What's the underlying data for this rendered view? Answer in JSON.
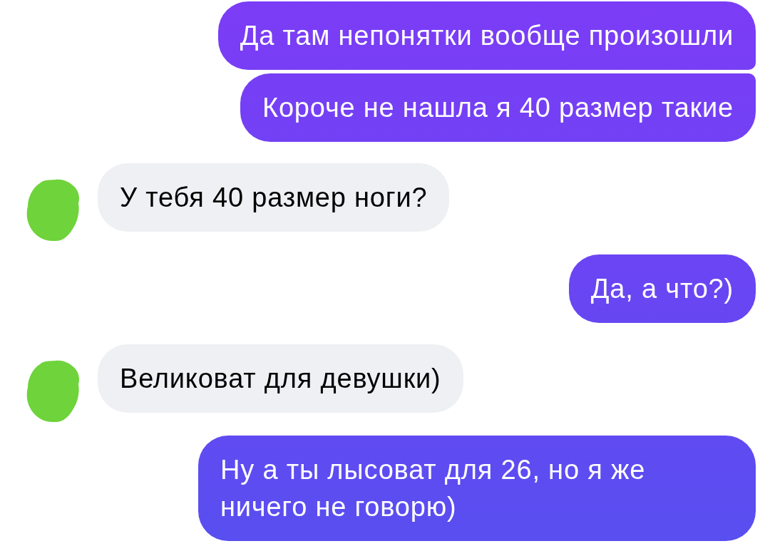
{
  "messages": [
    {
      "kind": "outgoing",
      "text": "Да там непонятки вообще произошли"
    },
    {
      "kind": "outgoing",
      "text": "Короче не нашла я 40 размер такие"
    },
    {
      "kind": "incoming",
      "text": "У тебя 40 размер ноги?"
    },
    {
      "kind": "outgoing",
      "text": "Да, а что?)"
    },
    {
      "kind": "incoming",
      "text": "Великоват для девушки)"
    },
    {
      "kind": "outgoing",
      "text": "Ну а ты лысоват для 26, но я же ничего не говорю)"
    }
  ]
}
